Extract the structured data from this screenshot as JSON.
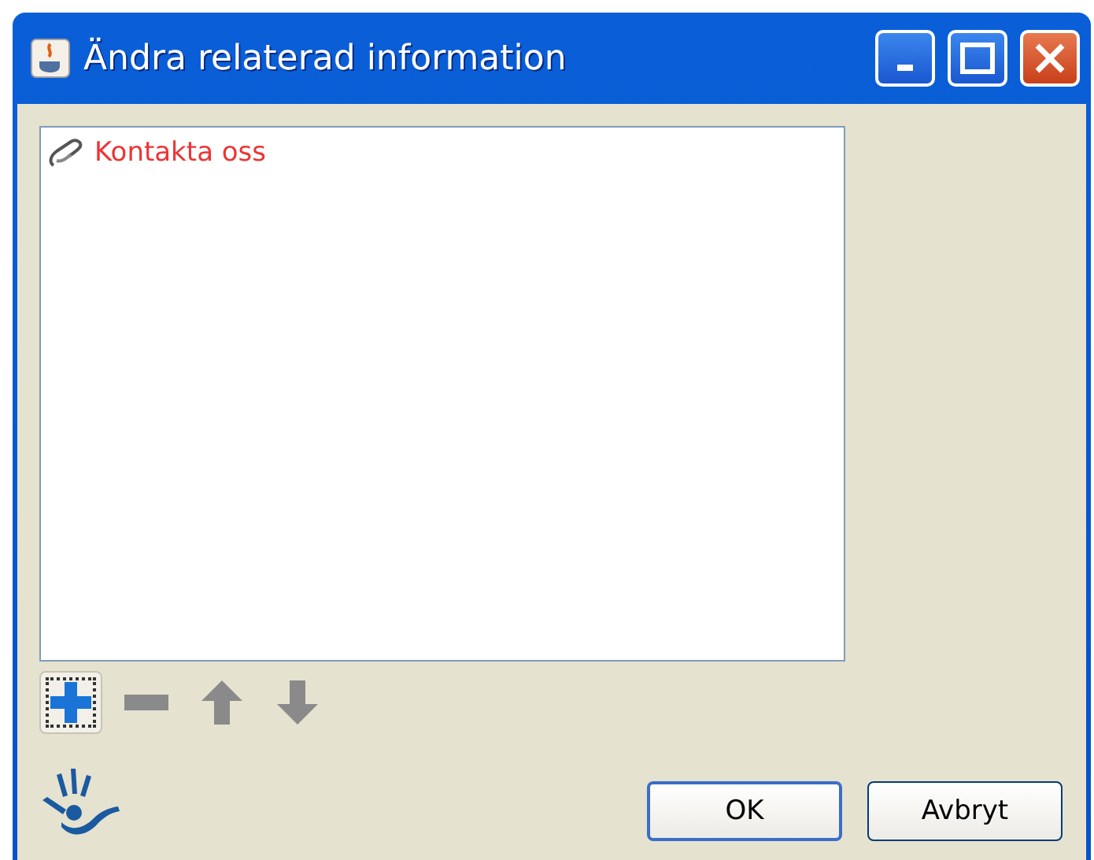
{
  "window": {
    "title": "Ändra relaterad information"
  },
  "list": {
    "items": [
      {
        "label": "Kontakta oss",
        "color": "#ee3333"
      }
    ]
  },
  "toolbar": [
    {
      "kind": "add",
      "focused": true,
      "disabled": false
    },
    {
      "kind": "remove",
      "focused": false,
      "disabled": true
    },
    {
      "kind": "up",
      "focused": false,
      "disabled": true
    },
    {
      "kind": "down",
      "focused": false,
      "disabled": true
    }
  ],
  "buttons": [
    {
      "label": "OK",
      "default": true
    },
    {
      "label": "Avbryt",
      "default": false
    }
  ]
}
